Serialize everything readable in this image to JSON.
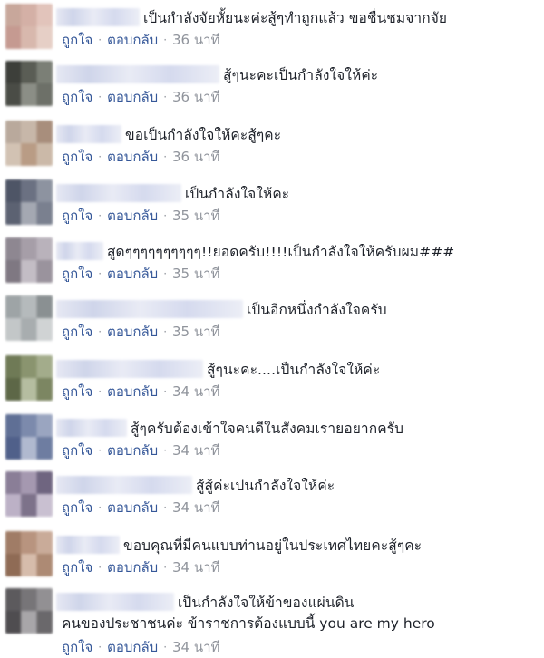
{
  "comments": [
    {
      "name_width": 92,
      "text": "เป็นกำลังจัยหั้ยนะค่ะสู้ๆทำถูกแล้ว ขอชื่นชมจากจัย",
      "extra_line": "",
      "like": "ถูกใจ",
      "reply": "ตอบกลับ",
      "time": "36 นาที",
      "avatar": [
        "#c8a79b",
        "#d4b0a6",
        "#e2c4bb",
        "#c59a91",
        "#d8b8ad",
        "#e6cfc6"
      ]
    },
    {
      "name_width": 180,
      "text": "สู้ๆนะคะเป็นกำลังใจให้ค่ะ",
      "extra_line": "",
      "like": "ถูกใจ",
      "reply": "ตอบกลับ",
      "time": "36 นาที",
      "avatar": [
        "#3d3f3a",
        "#5a5d55",
        "#7b7f76",
        "#4a4c46",
        "#8b8e86",
        "#6d7068"
      ]
    },
    {
      "name_width": 72,
      "text": "ขอเป็นกำลังใจให้คะสู้ๆคะ",
      "extra_line": "",
      "like": "ถูกใจ",
      "reply": "ตอบกลับ",
      "time": "36 นาที",
      "avatar": [
        "#b9a99c",
        "#c7b7a9",
        "#a88e7c",
        "#d2c2b3",
        "#b99c85",
        "#cbb9a8"
      ]
    },
    {
      "name_width": 138,
      "text": "เป็นกำลังใจให้คะ",
      "extra_line": "",
      "like": "ถูกใจ",
      "reply": "ตอบกลับ",
      "time": "35 นาที",
      "avatar": [
        "#4e5566",
        "#6b7182",
        "#8d93a0",
        "#5c6272",
        "#a4a8b2",
        "#7a808f"
      ]
    },
    {
      "name_width": 52,
      "text": "สูดๆๆๆๆๆๆๆๆๆๆ!!ยอดครับ!!!!เป็นกำลังใจให้ครับผม###",
      "extra_line": "",
      "like": "ถูกใจ",
      "reply": "ตอบกลับ",
      "time": "35 นาที",
      "avatar": [
        "#8e8791",
        "#a69ea8",
        "#b9b2bb",
        "#7f7882",
        "#c3bdc5",
        "#9a939d"
      ]
    },
    {
      "name_width": 206,
      "text": "เป็นอีกหนึ่งกำลังใจครับ",
      "extra_line": "",
      "like": "ถูกใจ",
      "reply": "ตอบกลับ",
      "time": "35 นาที",
      "avatar": [
        "#9ea4a6",
        "#b5babc",
        "#8a9092",
        "#c3c7c8",
        "#a8adaf",
        "#d0d3d4"
      ]
    },
    {
      "name_width": 162,
      "text": "สู้ๆนะคะ....เป็นกำลังใจให้ค่ะ",
      "extra_line": "",
      "like": "ถูกใจ",
      "reply": "ตอบกลับ",
      "time": "34 นาที",
      "avatar": [
        "#6f7a56",
        "#8a946f",
        "#a3ac8b",
        "#5d6747",
        "#b5bda0",
        "#7c8662"
      ]
    },
    {
      "name_width": 78,
      "text": "สู้ๆครับต้องเข้าใจคนดีในสังคมเรายอยากครับ",
      "extra_line": "",
      "like": "ถูกใจ",
      "reply": "ตอบกลับ",
      "time": "34 นาที",
      "avatar": [
        "#5f6f95",
        "#7c8aac",
        "#9aa5c0",
        "#50608a",
        "#b0b9cf",
        "#6e7da1"
      ]
    },
    {
      "name_width": 150,
      "text": "สู้สู้ค่ะเปนกำลังใจให้ค่ะ",
      "extra_line": "",
      "like": "ถูกใจ",
      "reply": "ตอบกลับ",
      "time": "34 นาที",
      "avatar": [
        "#8a7e97",
        "#a598b0",
        "#6f6580",
        "#bcb1c6",
        "#7d728a",
        "#c9c0d1"
      ]
    },
    {
      "name_width": 70,
      "text": "ขอบคุณที่มีคนแบบท่านอยู่ในประเทศไทยคะสู้ๆคะ",
      "extra_line": "",
      "like": "ถูกใจ",
      "reply": "ตอบกลับ",
      "time": "34 นาที",
      "avatar": [
        "#a07c66",
        "#b8947f",
        "#c9ab99",
        "#8f6b55",
        "#d6bcab",
        "#ad8a74"
      ]
    },
    {
      "name_width": 130,
      "text": "เป็นกำลังใจให้ข้าของแผ่นดิน",
      "extra_line": "คนของประชาชนค่ะ ข้าราชการต้องแบบนี้ you are my hero",
      "like": "ถูกใจ",
      "reply": "ตอบกลับ",
      "time": "34 นาที",
      "avatar": [
        "#5c5a5d",
        "#777578",
        "#929093",
        "#4f4d50",
        "#a8a6a9",
        "#6a686b"
      ]
    }
  ]
}
